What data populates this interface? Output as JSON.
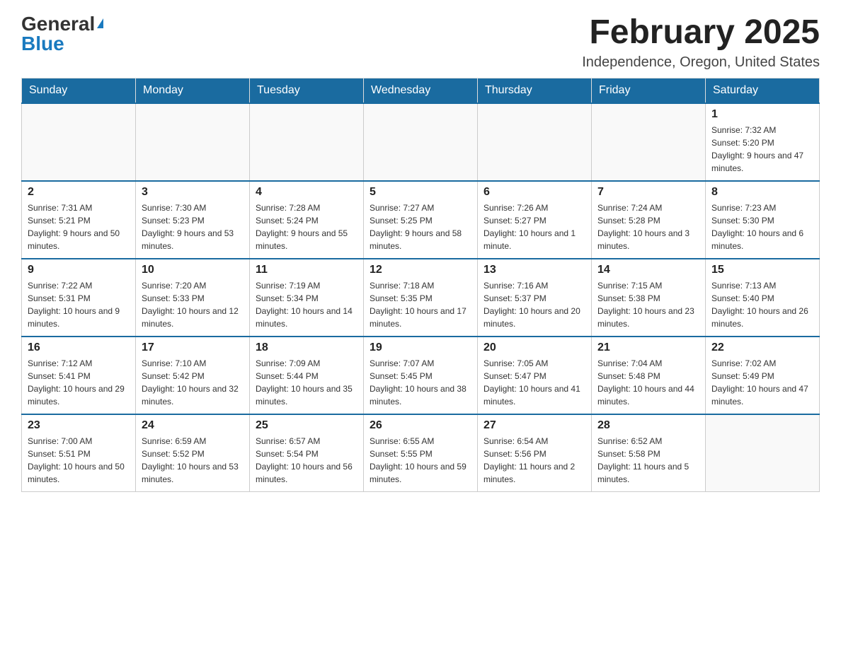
{
  "header": {
    "logo": {
      "general": "General",
      "triangle": "▶",
      "blue": "Blue"
    },
    "title": "February 2025",
    "location": "Independence, Oregon, United States"
  },
  "days_of_week": [
    "Sunday",
    "Monday",
    "Tuesday",
    "Wednesday",
    "Thursday",
    "Friday",
    "Saturday"
  ],
  "weeks": [
    [
      {
        "day": "",
        "info": ""
      },
      {
        "day": "",
        "info": ""
      },
      {
        "day": "",
        "info": ""
      },
      {
        "day": "",
        "info": ""
      },
      {
        "day": "",
        "info": ""
      },
      {
        "day": "",
        "info": ""
      },
      {
        "day": "1",
        "info": "Sunrise: 7:32 AM\nSunset: 5:20 PM\nDaylight: 9 hours and 47 minutes."
      }
    ],
    [
      {
        "day": "2",
        "info": "Sunrise: 7:31 AM\nSunset: 5:21 PM\nDaylight: 9 hours and 50 minutes."
      },
      {
        "day": "3",
        "info": "Sunrise: 7:30 AM\nSunset: 5:23 PM\nDaylight: 9 hours and 53 minutes."
      },
      {
        "day": "4",
        "info": "Sunrise: 7:28 AM\nSunset: 5:24 PM\nDaylight: 9 hours and 55 minutes."
      },
      {
        "day": "5",
        "info": "Sunrise: 7:27 AM\nSunset: 5:25 PM\nDaylight: 9 hours and 58 minutes."
      },
      {
        "day": "6",
        "info": "Sunrise: 7:26 AM\nSunset: 5:27 PM\nDaylight: 10 hours and 1 minute."
      },
      {
        "day": "7",
        "info": "Sunrise: 7:24 AM\nSunset: 5:28 PM\nDaylight: 10 hours and 3 minutes."
      },
      {
        "day": "8",
        "info": "Sunrise: 7:23 AM\nSunset: 5:30 PM\nDaylight: 10 hours and 6 minutes."
      }
    ],
    [
      {
        "day": "9",
        "info": "Sunrise: 7:22 AM\nSunset: 5:31 PM\nDaylight: 10 hours and 9 minutes."
      },
      {
        "day": "10",
        "info": "Sunrise: 7:20 AM\nSunset: 5:33 PM\nDaylight: 10 hours and 12 minutes."
      },
      {
        "day": "11",
        "info": "Sunrise: 7:19 AM\nSunset: 5:34 PM\nDaylight: 10 hours and 14 minutes."
      },
      {
        "day": "12",
        "info": "Sunrise: 7:18 AM\nSunset: 5:35 PM\nDaylight: 10 hours and 17 minutes."
      },
      {
        "day": "13",
        "info": "Sunrise: 7:16 AM\nSunset: 5:37 PM\nDaylight: 10 hours and 20 minutes."
      },
      {
        "day": "14",
        "info": "Sunrise: 7:15 AM\nSunset: 5:38 PM\nDaylight: 10 hours and 23 minutes."
      },
      {
        "day": "15",
        "info": "Sunrise: 7:13 AM\nSunset: 5:40 PM\nDaylight: 10 hours and 26 minutes."
      }
    ],
    [
      {
        "day": "16",
        "info": "Sunrise: 7:12 AM\nSunset: 5:41 PM\nDaylight: 10 hours and 29 minutes."
      },
      {
        "day": "17",
        "info": "Sunrise: 7:10 AM\nSunset: 5:42 PM\nDaylight: 10 hours and 32 minutes."
      },
      {
        "day": "18",
        "info": "Sunrise: 7:09 AM\nSunset: 5:44 PM\nDaylight: 10 hours and 35 minutes."
      },
      {
        "day": "19",
        "info": "Sunrise: 7:07 AM\nSunset: 5:45 PM\nDaylight: 10 hours and 38 minutes."
      },
      {
        "day": "20",
        "info": "Sunrise: 7:05 AM\nSunset: 5:47 PM\nDaylight: 10 hours and 41 minutes."
      },
      {
        "day": "21",
        "info": "Sunrise: 7:04 AM\nSunset: 5:48 PM\nDaylight: 10 hours and 44 minutes."
      },
      {
        "day": "22",
        "info": "Sunrise: 7:02 AM\nSunset: 5:49 PM\nDaylight: 10 hours and 47 minutes."
      }
    ],
    [
      {
        "day": "23",
        "info": "Sunrise: 7:00 AM\nSunset: 5:51 PM\nDaylight: 10 hours and 50 minutes."
      },
      {
        "day": "24",
        "info": "Sunrise: 6:59 AM\nSunset: 5:52 PM\nDaylight: 10 hours and 53 minutes."
      },
      {
        "day": "25",
        "info": "Sunrise: 6:57 AM\nSunset: 5:54 PM\nDaylight: 10 hours and 56 minutes."
      },
      {
        "day": "26",
        "info": "Sunrise: 6:55 AM\nSunset: 5:55 PM\nDaylight: 10 hours and 59 minutes."
      },
      {
        "day": "27",
        "info": "Sunrise: 6:54 AM\nSunset: 5:56 PM\nDaylight: 11 hours and 2 minutes."
      },
      {
        "day": "28",
        "info": "Sunrise: 6:52 AM\nSunset: 5:58 PM\nDaylight: 11 hours and 5 minutes."
      },
      {
        "day": "",
        "info": ""
      }
    ]
  ]
}
